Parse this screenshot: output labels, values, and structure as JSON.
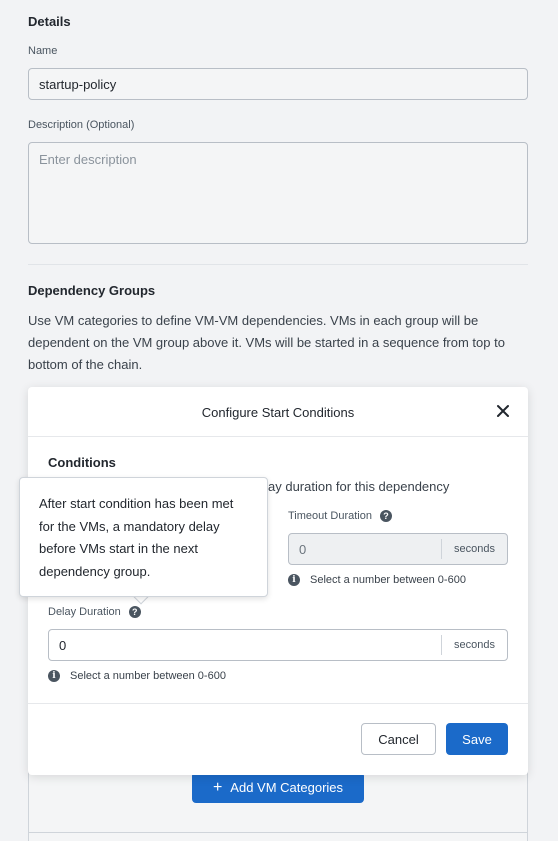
{
  "details": {
    "title": "Details",
    "name_label": "Name",
    "name_value": "startup-policy",
    "description_label": "Description (Optional)",
    "description_placeholder": "Enter description"
  },
  "dependency": {
    "title": "Dependency Groups",
    "description": "Use VM categories to define VM-VM dependencies. VMs in each group will be dependent on the VM group above it. VMs will be started in a sequence from top to bottom of the chain.",
    "add_button_label": "Add VM Categories",
    "add_button_icon": "+"
  },
  "modal": {
    "title": "Configure Start Conditions",
    "close_icon": "×",
    "conditions_title": "Conditions",
    "conditions_desc_visible": "ay duration for this dependency",
    "timeout": {
      "label": "Timeout Duration",
      "value": "0",
      "unit": "seconds",
      "hint": "Select a number between 0-600"
    },
    "delay": {
      "label": "Delay Duration",
      "value": "0",
      "unit": "seconds",
      "hint": "Select a number between 0-600"
    },
    "cancel_label": "Cancel",
    "save_label": "Save"
  },
  "tooltip": {
    "text": "After start condition has been met for the VMs, a mandatory delay before VMs start in the next dependency group."
  },
  "colors": {
    "primary": "#1b6ac9",
    "background": "#f2f3f5",
    "text": "#22272e"
  }
}
